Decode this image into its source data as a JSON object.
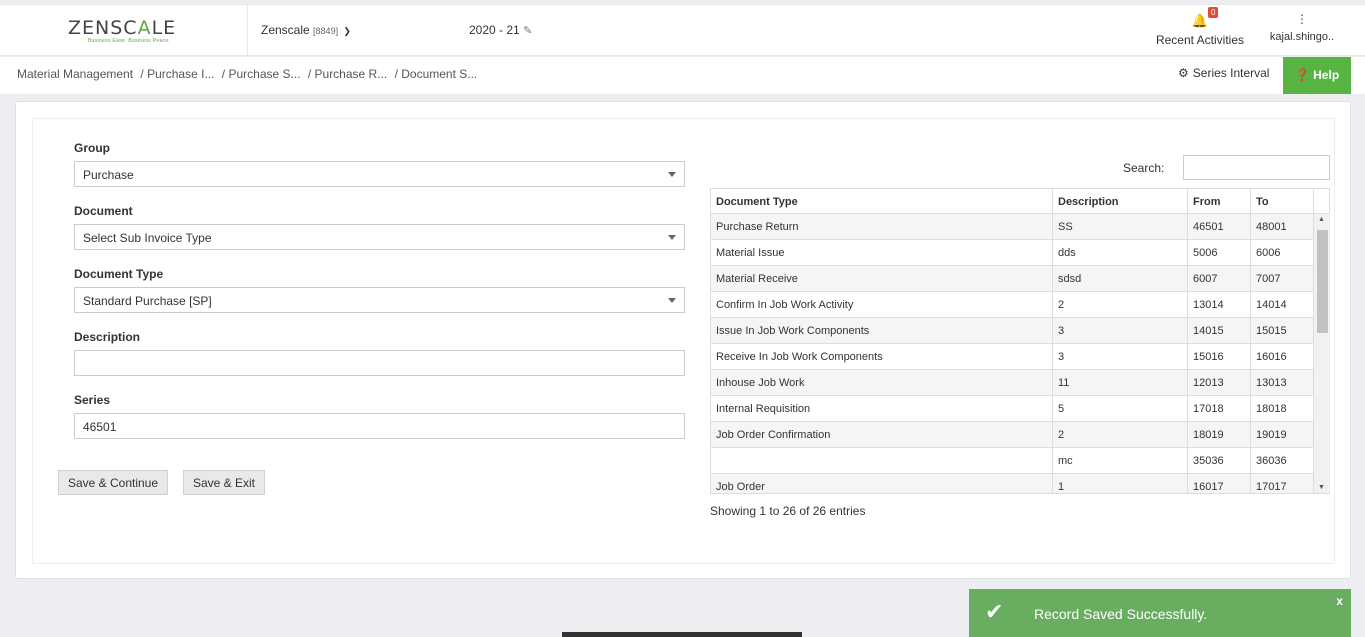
{
  "header": {
    "logo_main": "ZENSC",
    "logo_accent": "A",
    "logo_tail": "LE",
    "logo_tagline": "Business Ease. Business Peace.",
    "company_name": "Zenscale",
    "company_code": "[8849]",
    "fiscal_year": "2020 - 21",
    "recent_label": "Recent Activities",
    "recent_count": "0",
    "user_name": "kajal.shingo.."
  },
  "breadcrumb": [
    "Material Management",
    "/ Purchase I...",
    "/ Purchase S...",
    "/ Purchase R...",
    "/ Document S..."
  ],
  "series_interval_label": "Series Interval",
  "help_label": "Help",
  "form": {
    "group_label": "Group",
    "group_value": "Purchase",
    "document_label": "Document",
    "document_value": "Select Sub Invoice Type",
    "doctype_label": "Document Type",
    "doctype_value": "Standard Purchase [SP]",
    "description_label": "Description",
    "description_value": "",
    "series_label": "Series",
    "series_value": "46501",
    "save_continue": "Save & Continue",
    "save_exit": "Save & Exit"
  },
  "table": {
    "search_label": "Search:",
    "columns": [
      "Document Type",
      "Description",
      "From",
      "To"
    ],
    "rows": [
      [
        "Purchase Return",
        "SS",
        "46501",
        "48001"
      ],
      [
        "Material Issue",
        "dds",
        "5006",
        "6006"
      ],
      [
        "Material Receive",
        "sdsd",
        "6007",
        "7007"
      ],
      [
        "Confirm In Job Work Activity",
        "2",
        "13014",
        "14014"
      ],
      [
        "Issue In Job Work Components",
        "3",
        "14015",
        "15015"
      ],
      [
        "Receive In Job Work Components",
        "3",
        "15016",
        "16016"
      ],
      [
        "Inhouse Job Work",
        "11",
        "12013",
        "13013"
      ],
      [
        "Internal Requisition",
        "5",
        "17018",
        "18018"
      ],
      [
        "Job Order Confirmation",
        "2",
        "18019",
        "19019"
      ],
      [
        "",
        "mc",
        "35036",
        "36036"
      ],
      [
        "Job Order",
        "1",
        "16017",
        "17017"
      ]
    ],
    "showing": "Showing 1 to 26 of 26 entries"
  },
  "toast": {
    "message": "Record Saved Successfully.",
    "close": "x"
  }
}
